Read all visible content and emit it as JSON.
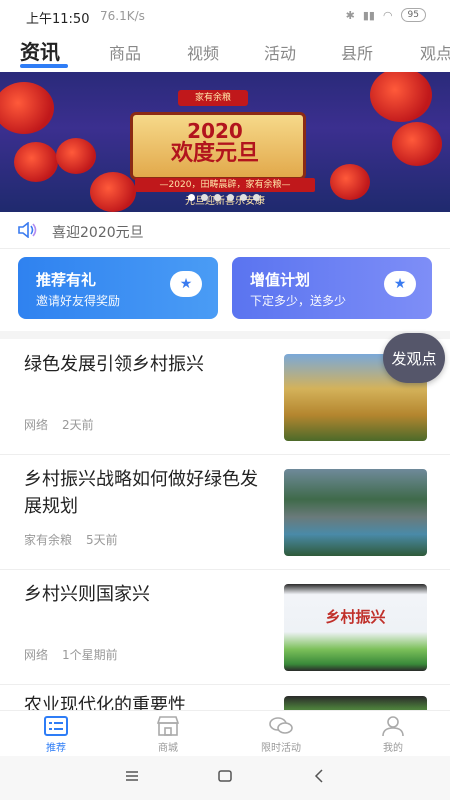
{
  "status": {
    "time": "上午11:50",
    "speed": "76.1K/s",
    "battery": "95"
  },
  "tabs": [
    {
      "label": "资讯",
      "active": true
    },
    {
      "label": "商品"
    },
    {
      "label": "视频"
    },
    {
      "label": "活动"
    },
    {
      "label": "县所"
    },
    {
      "label": "观点"
    }
  ],
  "banner": {
    "tag": "家有余粮",
    "year": "2020",
    "slogan": "欢度元旦",
    "sub": "—2020，田畴晨辟，家有余粮—",
    "sub2": "元旦迎新喜乐安康",
    "dots": 6,
    "active_dot": 0
  },
  "notice": {
    "text": "喜迎2020元旦"
  },
  "promo_cards": [
    {
      "title": "推荐有礼",
      "subtitle": "邀请好友得奖励"
    },
    {
      "title": "增值计划",
      "subtitle": "下定多少，送多少"
    }
  ],
  "fab": {
    "label": "发观点"
  },
  "news": [
    {
      "title": "绿色发展引领乡村振兴",
      "source": "网络",
      "time": "2天前"
    },
    {
      "title": "乡村振兴战略如何做好绿色发展规划",
      "source": "家有余粮",
      "time": "5天前"
    },
    {
      "title": "乡村兴则国家兴",
      "source": "网络",
      "time": "1个星期前",
      "thumb_text": "乡村振兴"
    },
    {
      "title": "农业现代化的重要性",
      "source": "",
      "time": ""
    }
  ],
  "bottom_nav": [
    {
      "label": "推荐",
      "icon": "list-icon",
      "active": true
    },
    {
      "label": "商城",
      "icon": "store-icon"
    },
    {
      "label": "限时活动",
      "icon": "chat-icon"
    },
    {
      "label": "我的",
      "icon": "person-icon"
    }
  ],
  "colors": {
    "accent": "#2e7df6",
    "card1": "#2f82f0",
    "card2": "#5a74f0",
    "fab": "#55566a"
  }
}
